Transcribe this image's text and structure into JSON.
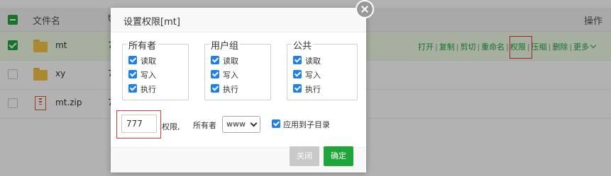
{
  "table": {
    "headers": {
      "filename": "文件名",
      "actions": "操作",
      "partial_col": "t"
    },
    "rows": [
      {
        "name": "mt",
        "partial": "7",
        "selected": true
      },
      {
        "name": "xy",
        "partial": "7",
        "selected": false
      },
      {
        "name": "mt.zip",
        "partial": "7",
        "selected": false
      }
    ],
    "operations": [
      "打开",
      "复制",
      "剪切",
      "重命名",
      "权限",
      "压缩",
      "删除",
      "更多"
    ],
    "more_icon": "chevron-down-icon"
  },
  "dialog": {
    "title": "设置权限[mt]",
    "groups": [
      {
        "legend": "所有者",
        "perms": [
          "读取",
          "写入",
          "执行"
        ]
      },
      {
        "legend": "用户组",
        "perms": [
          "读取",
          "写入",
          "执行"
        ]
      },
      {
        "legend": "公共",
        "perms": [
          "读取",
          "写入",
          "执行"
        ]
      }
    ],
    "permission_value": "777",
    "permission_label": "权限,",
    "owner_label": "所有者",
    "owner_value": "www",
    "apply_subdir_label": "应用到子目录",
    "close_button": "关闭",
    "ok_button": "确定"
  },
  "colors": {
    "accent": "#20a53a",
    "checkbox": "#1e7ff0",
    "highlight": "#e53935"
  }
}
